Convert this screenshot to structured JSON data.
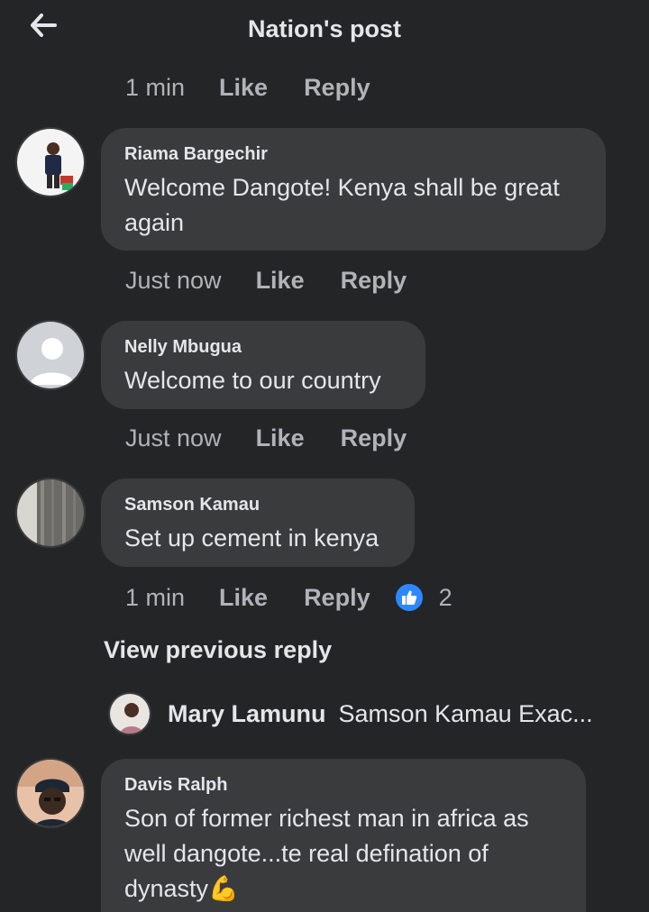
{
  "header": {
    "title": "Nation's post",
    "back_icon": "arrow-left-icon"
  },
  "top_actions": {
    "time": "1 min",
    "like": "Like",
    "reply": "Reply"
  },
  "comments": [
    {
      "name": "Riama Bargechir",
      "text_line1": "Welcome Dangote! Kenya shall be great",
      "text_line2": "again",
      "time": "Just now",
      "like": "Like",
      "reply": "Reply"
    },
    {
      "name": "Nelly Mbugua",
      "text": "Welcome to our country",
      "time": "Just now",
      "like": "Like",
      "reply": "Reply"
    },
    {
      "name": "Samson Kamau",
      "text": "Set up cement in kenya",
      "time": "1 min",
      "like": "Like",
      "reply": "Reply",
      "reaction_icon": "thumbs-up-icon",
      "reaction_count": "2"
    },
    {
      "name": "Davis Ralph",
      "text_line1": "Son of former richest man in africa as",
      "text_line2": "well dangote...te real defination of",
      "text_line3": "dynasty💪"
    }
  ],
  "view_previous": "View previous reply",
  "preview_reply": {
    "name": "Mary Lamunu",
    "text": "Samson Kamau Exac..."
  },
  "colors": {
    "background": "#242527",
    "bubble": "#3a3b3c",
    "text": "#e4e6eb",
    "muted": "#b0b3b8",
    "like_blue": "#2d88ff"
  }
}
